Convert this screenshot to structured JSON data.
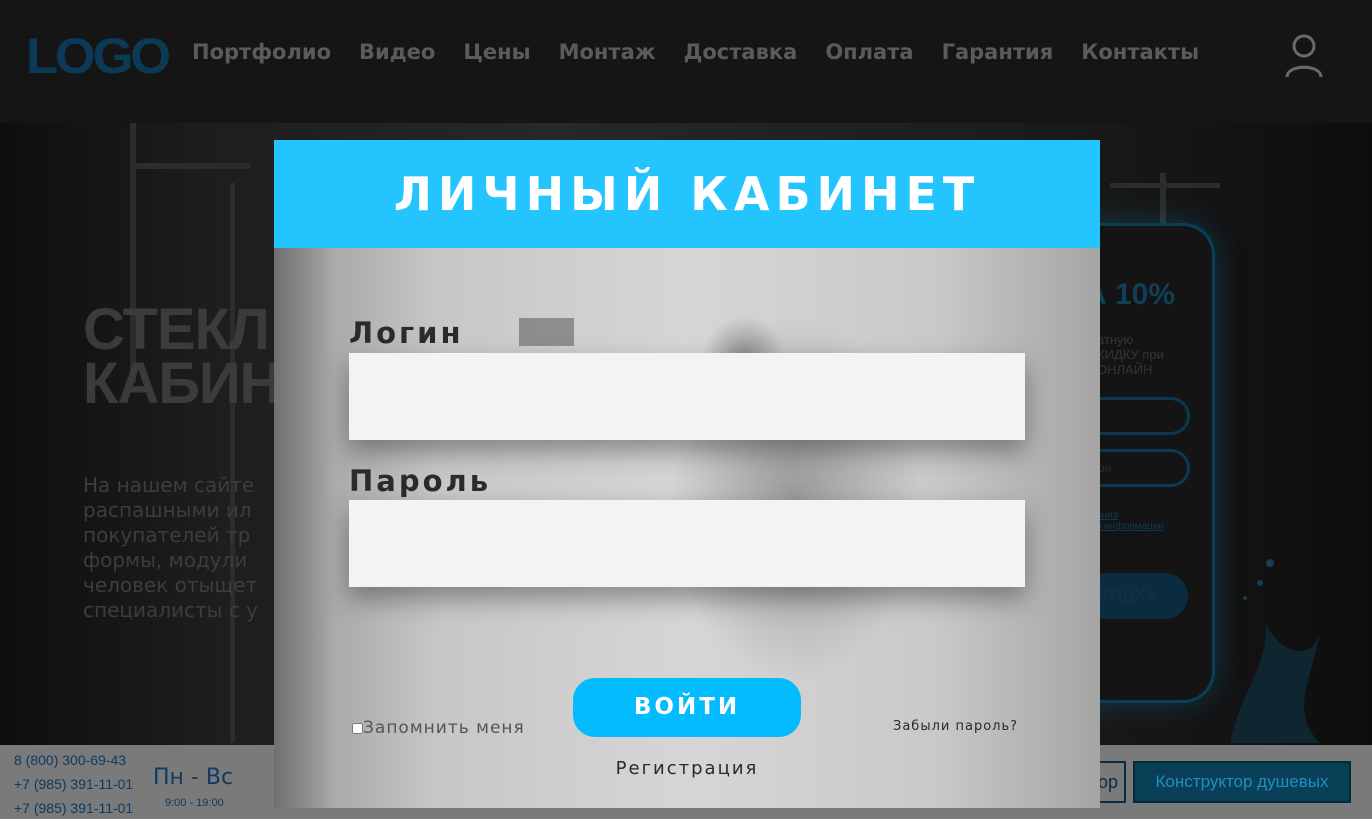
{
  "header": {
    "logo": "LOGO",
    "nav": [
      "Портфолио",
      "Видео",
      "Цены",
      "Монтаж",
      "Доставка",
      "Оплата",
      "Гарантия",
      "Контакты"
    ]
  },
  "hero": {
    "title_line1": "СТЕКЛ",
    "title_line2": "КАБИН",
    "text_lines": [
      "На нашем сайте",
      "распашными ил",
      "покупателей тр",
      "формы, модули",
      "человек отыщет",
      "специалисты с у"
    ]
  },
  "promo": {
    "discount": "А 10%",
    "lines": [
      "атную",
      "КИДКУ при",
      "ОНЛАЙН"
    ],
    "field2_text": "он",
    "link_lines": [
      "ания",
      "о информации"
    ],
    "button": "КИДКУ"
  },
  "footer": {
    "phones": [
      "8 (800) 300-69-43",
      "+7 (985) 391-11-01",
      "+7 (985) 391-11-01"
    ],
    "days": "Пн - Вс",
    "hours": "9:00 - 19:00",
    "button1": "ор",
    "button2": "Конструктор душевых"
  },
  "modal": {
    "title": "ЛИЧНЫЙ КАБИНЕТ",
    "login_label": "Логин",
    "password_label": "Пароль",
    "remember_label": "Запомнить меня",
    "forgot_link": "Забыли пароль?",
    "login_button": "ВОЙТИ",
    "register_link": "Регистрация"
  },
  "colors": {
    "accent": "#24c4ff",
    "button": "#03bcff",
    "header_bg": "#151515",
    "footer_bg": "#7a7a7a"
  },
  "icons": {
    "user": "user-icon"
  }
}
